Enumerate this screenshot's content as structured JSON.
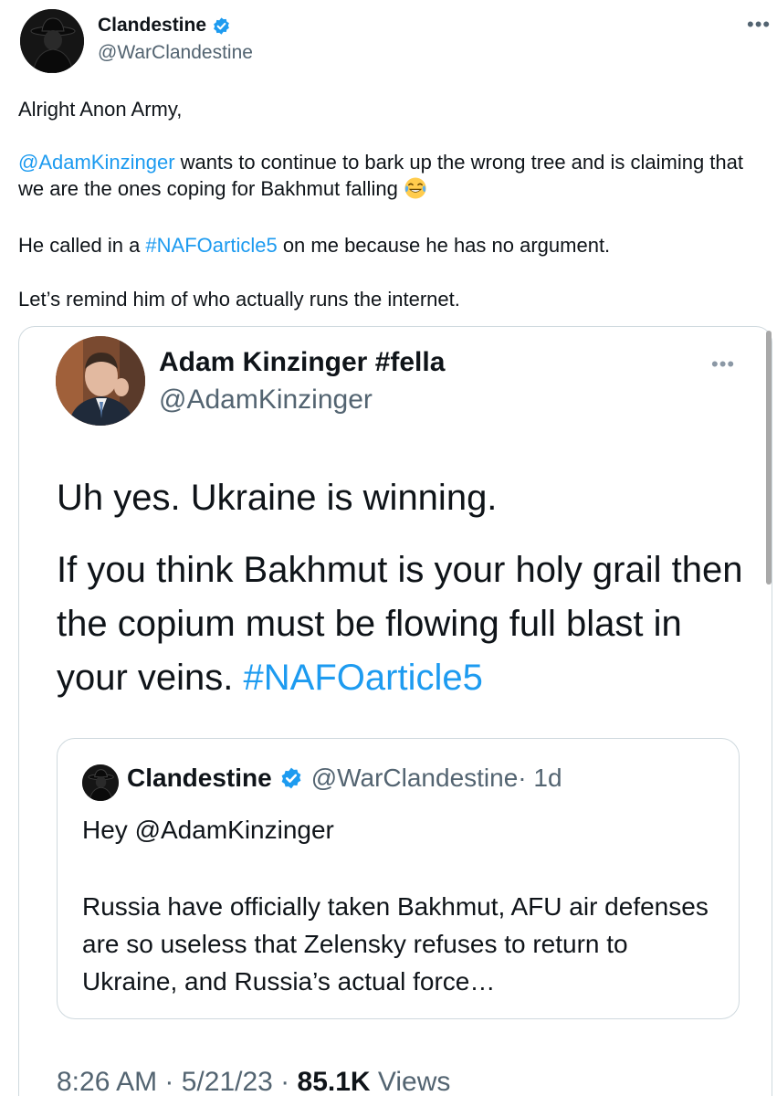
{
  "tweet": {
    "author_name": "Clandestine",
    "author_handle": "@WarClandestine",
    "more_label": "•••",
    "para1": "Alright Anon Army,",
    "para2_mention": "@AdamKinzinger",
    "para2_text": " wants to continue to bark up the wrong tree and is claiming that we are the ones coping for Bakhmut falling ",
    "para2_emoji": "face-with-tears-of-joy-icon",
    "para3_pre": "He called in a ",
    "para3_hashtag": "#NAFOarticle5",
    "para3_post": " on me because he has no argument.",
    "para4": "Let’s remind him of who actually runs the internet."
  },
  "quoted": {
    "author_name": "Adam Kinzinger #fella",
    "author_handle": "@AdamKinzinger",
    "more_label": "•••",
    "line1": "Uh yes.  Ukraine is winning.",
    "para_text": "If you think Bakhmut is your holy grail then the copium must be flowing full blast in your veins.  ",
    "para_hashtag": "#NAFOarticle5",
    "inner": {
      "author_name": "Clandestine",
      "author_handle": "@WarClandestine",
      "time": " · 1d",
      "greeting": "Hey @AdamKinzinger",
      "text": "Russia have officially taken Bakhmut, AFU air defenses are so useless that Zelensky refuses to return to Ukraine, and Russia’s actual force…"
    },
    "footer": {
      "time": "8:26 AM",
      "sep1": " · ",
      "date": "5/21/23",
      "sep2": " · ",
      "views_count": "85.1K",
      "views_label": " Views"
    }
  },
  "colors": {
    "link": "#1d9bf0",
    "verified": "#1d9bf0",
    "secondary_text": "#536471",
    "border": "#cfd9de"
  }
}
